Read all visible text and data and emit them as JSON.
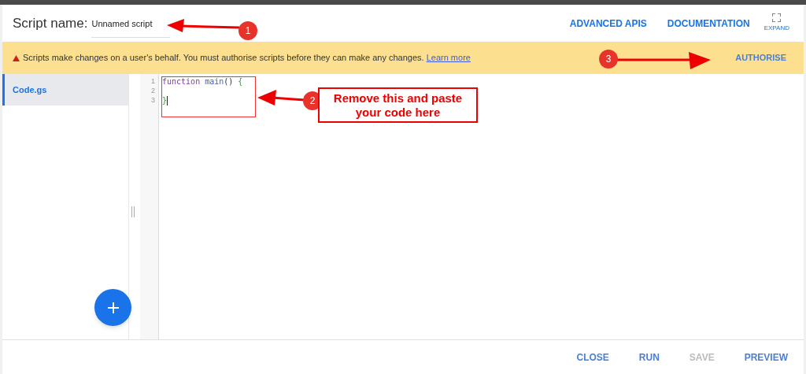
{
  "header": {
    "label": "Script name:",
    "script_name": "Unnamed script",
    "links": [
      "ADVANCED APIS",
      "DOCUMENTATION"
    ],
    "expand": {
      "label": "EXPAND"
    }
  },
  "banner": {
    "message": "Scripts make changes on a user's behalf. You must authorise scripts before they can make any changes.",
    "link": "Learn more",
    "action": "AUTHORISE"
  },
  "files": [
    {
      "name": "Code.gs",
      "selected": true
    }
  ],
  "editor": {
    "lines": [
      {
        "number": "1",
        "tokens": [
          {
            "kind": "keyword",
            "text": "function"
          },
          {
            "kind": "name",
            "text": "main"
          },
          {
            "kind": "plain",
            "text": "() "
          },
          {
            "kind": "bracket",
            "text": "{"
          }
        ]
      },
      {
        "number": "2"
      },
      {
        "number": "3",
        "tokens": [
          {
            "kind": "bracket",
            "text": "}"
          }
        ],
        "cursor": true
      }
    ]
  },
  "footer": {
    "buttons": [
      {
        "label": "CLOSE",
        "disabled": false
      },
      {
        "label": "RUN",
        "disabled": false
      },
      {
        "label": "SAVE",
        "disabled": true
      },
      {
        "label": "PREVIEW",
        "disabled": false
      }
    ]
  },
  "annotations": [
    {
      "number": "1"
    },
    {
      "number": "2",
      "callout": "Remove this and paste your code here"
    },
    {
      "number": "3"
    }
  ]
}
